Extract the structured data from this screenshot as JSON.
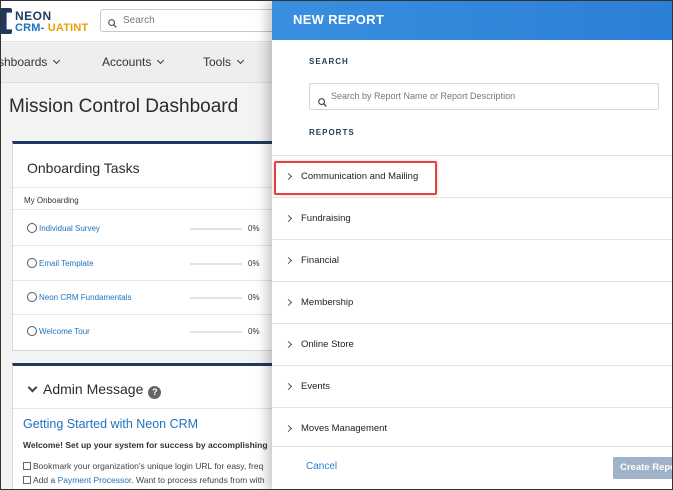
{
  "app": {
    "logo_top": "NEON",
    "logo_bottom_a": "CRM-",
    "logo_bottom_b": " UATINT",
    "search_placeholder": "Search"
  },
  "nav": {
    "items": [
      {
        "label": "shboards"
      },
      {
        "label": "Accounts"
      },
      {
        "label": "Tools"
      }
    ]
  },
  "dashboard": {
    "title": "Mission Control Dashboard",
    "onboarding": {
      "title": "Onboarding Tasks",
      "subtitle": "My Onboarding",
      "tasks": [
        {
          "label": "Individual Survey",
          "percent": "0%"
        },
        {
          "label": "Email Template",
          "percent": "0%"
        },
        {
          "label": "Neon CRM Fundamentals",
          "percent": "0%"
        },
        {
          "label": "Welcome Tour",
          "percent": "0%"
        }
      ]
    },
    "admin": {
      "title": "Admin Message",
      "help": "?",
      "link_title": "Getting Started with Neon CRM",
      "welcome": "Welcome! Set up your system for success by accomplishing",
      "line1": "Bookmark your organization's unique login URL for easy, freq",
      "line2_a": "Add a ",
      "line2_link": "Payment Processor",
      "line2_b": ". Want to process refunds from with"
    }
  },
  "drawer": {
    "title": "NEW REPORT",
    "search_label": "SEARCH",
    "search_placeholder": "Search by Report Name or Report Description",
    "reports_label": "REPORTS",
    "categories": [
      {
        "label": "Communication and Mailing",
        "highlighted": true
      },
      {
        "label": "Fundraising"
      },
      {
        "label": "Financial"
      },
      {
        "label": "Membership"
      },
      {
        "label": "Online Store"
      },
      {
        "label": "Events"
      },
      {
        "label": "Moves Management"
      }
    ],
    "cancel_label": "Cancel",
    "create_label": "Create Report"
  },
  "colors": {
    "header_blue": "#2c7fd6",
    "link_blue": "#1e73be",
    "highlight_red": "#e04545",
    "brand_navy": "#1e3a5f",
    "brand_accent": "#e8a200"
  }
}
